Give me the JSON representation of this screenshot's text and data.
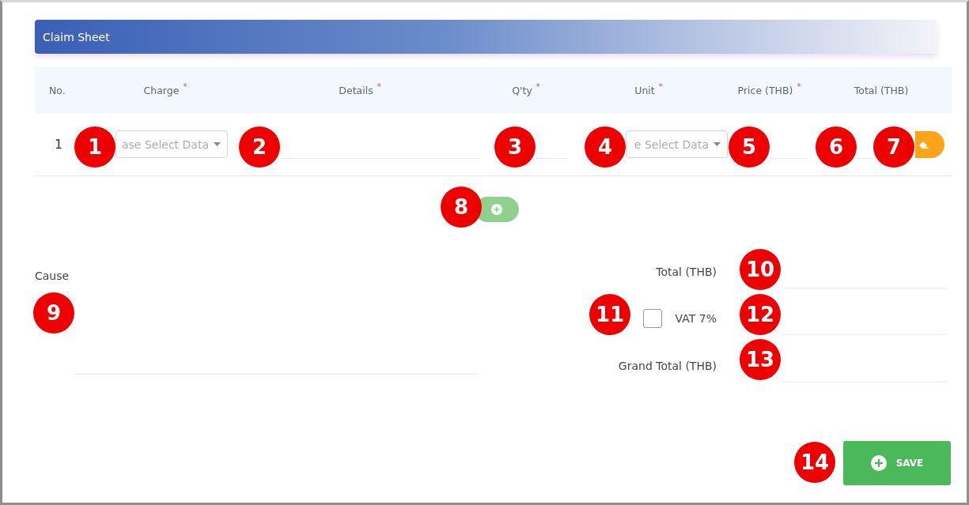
{
  "header": {
    "title": "Claim Sheet"
  },
  "table": {
    "columns": [
      {
        "label": "No."
      },
      {
        "label": "Charge",
        "mark": "*"
      },
      {
        "label": "Details",
        "mark": "*"
      },
      {
        "label": "Q'ty",
        "mark": "*"
      },
      {
        "label": "Unit",
        "mark": "*"
      },
      {
        "label": "Price (THB)",
        "mark": "*"
      },
      {
        "label": "Total (THB)"
      }
    ],
    "rows": [
      {
        "no": "1",
        "charge": {
          "placeholder": "ase Select Data"
        },
        "unit": {
          "placeholder": "e Select Data"
        }
      }
    ]
  },
  "cause": {
    "label": "Cause"
  },
  "summary": [
    {
      "kind": "amount",
      "label": "Total (THB)"
    },
    {
      "kind": "vat",
      "label": "VAT 7%",
      "checked": false
    },
    {
      "kind": "amount",
      "label": "Grand Total (THB)"
    }
  ],
  "save_button": {
    "label": "SAVE"
  },
  "markers": [
    {
      "label": "1"
    },
    {
      "label": "2"
    },
    {
      "label": "3"
    },
    {
      "label": "4"
    },
    {
      "label": "5"
    },
    {
      "label": "6"
    },
    {
      "label": "7"
    },
    {
      "label": "8"
    },
    {
      "label": "9"
    },
    {
      "label": "10"
    },
    {
      "label": "11"
    },
    {
      "label": "12"
    },
    {
      "label": "13"
    },
    {
      "label": "14"
    }
  ]
}
